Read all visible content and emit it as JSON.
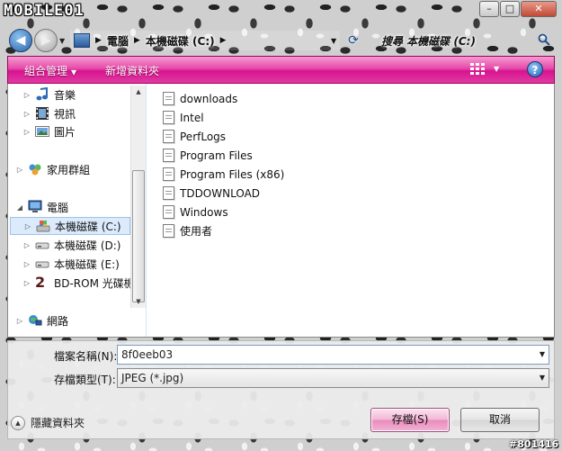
{
  "titlebar": {
    "logo_text": "MOBILE01",
    "minimize": "–",
    "maximize": "□",
    "close": "✕"
  },
  "nav": {
    "back_icon": "back-arrow-icon",
    "forward_icon": "forward-arrow-icon",
    "breadcrumb": [
      "電腦",
      "本機磁碟 (C:)"
    ],
    "search_placeholder": "搜尋 本機磁碟 (C:)"
  },
  "toolbar": {
    "organize": "組合管理",
    "new_folder": "新增資料夾",
    "help": "?"
  },
  "navpane": {
    "items": [
      {
        "label": "音樂",
        "icon": "music-icon"
      },
      {
        "label": "視訊",
        "icon": "video-icon"
      },
      {
        "label": "圖片",
        "icon": "pictures-icon"
      },
      {
        "label": "家用群組",
        "icon": "homegroup-icon"
      },
      {
        "label": "電腦",
        "icon": "computer-icon"
      },
      {
        "label": "本機磁碟 (C:)",
        "icon": "drive-c-icon"
      },
      {
        "label": "本機磁碟 (D:)",
        "icon": "drive-icon"
      },
      {
        "label": "本機磁碟 (E:)",
        "icon": "drive-icon"
      },
      {
        "label": "BD-ROM 光碟機",
        "icon": "bd-rom-icon"
      },
      {
        "label": "網路",
        "icon": "network-icon"
      }
    ]
  },
  "files": [
    "downloads",
    "Intel",
    "PerfLogs",
    "Program Files",
    "Program Files (x86)",
    "TDDOWNLOAD",
    "Windows",
    "使用者"
  ],
  "form": {
    "filename_label": "檔案名稱(N):",
    "filename_value": "8f0eeb03",
    "filetype_label": "存檔類型(T):",
    "filetype_value": "JPEG (*.jpg)"
  },
  "footer": {
    "hide_folders": "隱藏資料夾",
    "save": "存檔(S)",
    "cancel": "取消",
    "watermark": "#801416"
  },
  "colors": {
    "toolbar_accent": "#e33aa3",
    "selection": "#dcebfc"
  }
}
